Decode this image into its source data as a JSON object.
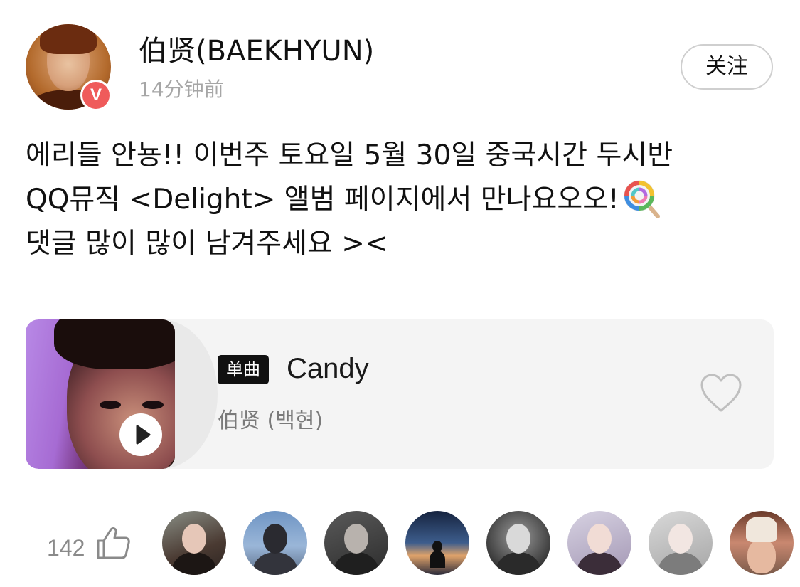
{
  "header": {
    "username": "伯贤(BAEKHYUN)",
    "timestamp": "14分钟前",
    "verified_badge": "V",
    "follow_label": "关注",
    "avatar_icon": "user-avatar"
  },
  "post": {
    "lines": [
      "에리들 안뇽!! 이번주 토요일 5월 30일 중국시간 두시반",
      "QQ뮤직 <Delight> 앨범 페이지에서 만나요오오!",
      "댓글 많이 많이 남겨주세요 ><"
    ],
    "emoji_icon": "lollipop-icon"
  },
  "music_card": {
    "badge": "单曲",
    "title": "Candy",
    "artist": "伯贤 (백현)",
    "play_icon": "play-icon",
    "like_icon": "heart-outline-icon"
  },
  "likes": {
    "count": "142",
    "icon": "thumbs-up-icon",
    "avatar_count_shown": 8
  },
  "colors": {
    "badge_red": "#ef5b5b",
    "muted_text": "#a6a6a6",
    "card_background": "#f4f4f4",
    "single_badge_bg": "#111111"
  }
}
